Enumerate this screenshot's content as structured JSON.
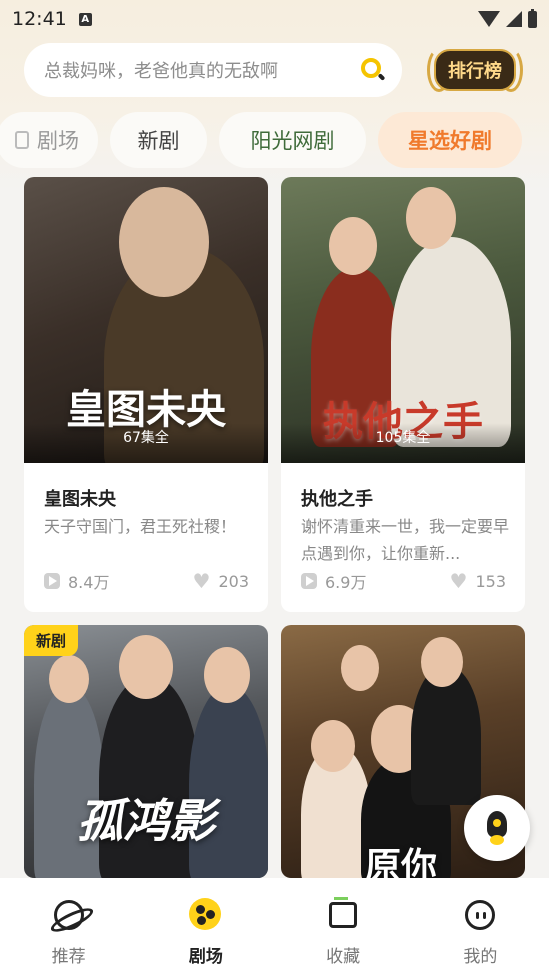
{
  "status_bar": {
    "time": "12:41",
    "notification_icon": "A"
  },
  "search": {
    "placeholder": "总裁妈咪，老爸他真的无敌啊",
    "icon": "search-icon"
  },
  "rank_button": {
    "label": "排行榜"
  },
  "tabs": [
    {
      "label": "剧场",
      "active": false
    },
    {
      "label": "新剧",
      "active": false
    },
    {
      "label": "阳光网剧",
      "active": false
    },
    {
      "label": "星选好剧",
      "active": true
    }
  ],
  "cards": [
    {
      "poster_title": "皇图未央",
      "episodes": "67集全",
      "title": "皇图未央",
      "desc": "天子守国门，君王死社稷！",
      "plays": "8.4万",
      "likes": "203"
    },
    {
      "poster_title": "执他之手",
      "episodes": "105集全",
      "title": "执他之手",
      "desc": "谢怀清重来一世，我一定要早点遇到你，让你重新...",
      "plays": "6.9万",
      "likes": "153"
    },
    {
      "poster_title": "孤鸿影",
      "badge": "新剧"
    },
    {
      "poster_title": "原你"
    }
  ],
  "bottom_nav": [
    {
      "label": "推荐",
      "icon": "planet-icon",
      "active": false
    },
    {
      "label": "剧场",
      "icon": "theater-icon",
      "active": true
    },
    {
      "label": "收藏",
      "icon": "bookmark-icon",
      "active": false
    },
    {
      "label": "我的",
      "icon": "profile-icon",
      "active": false
    }
  ],
  "colors": {
    "accent": "#ffd21a",
    "active_tab": "#f07a2c",
    "active_tab_bg": "#fde9d6"
  }
}
